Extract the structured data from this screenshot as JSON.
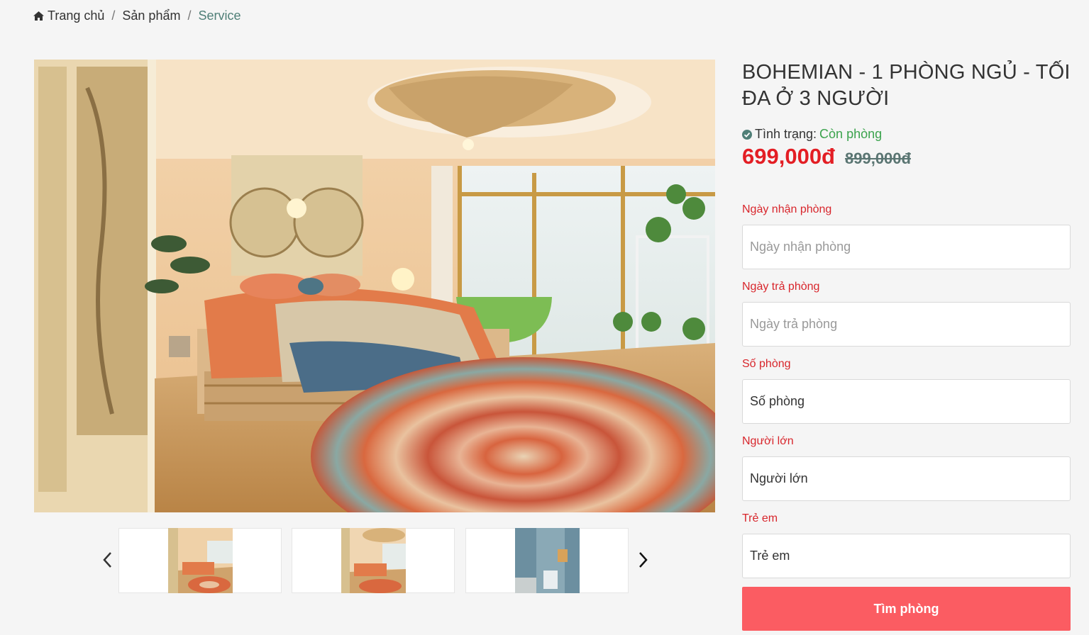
{
  "breadcrumb": {
    "home": "Trang chủ",
    "products": "Sản phẩm",
    "current": "Service",
    "separator": "/"
  },
  "product": {
    "title": "BOHEMIAN - 1 PHÒNG NGỦ - TỐI ĐA Ở 3 NGƯỜI",
    "status_label": "Tình trạng:",
    "status_value": "Còn phòng",
    "price_new": "699,000đ",
    "price_old": "899,000đ"
  },
  "form": {
    "checkin": {
      "label": "Ngày nhận phòng",
      "placeholder": "Ngày nhận phòng"
    },
    "checkout": {
      "label": "Ngày trả phòng",
      "placeholder": "Ngày trả phòng"
    },
    "rooms": {
      "label": "Số phòng",
      "placeholder": "Số phòng"
    },
    "adults": {
      "label": "Người lớn",
      "placeholder": "Người lớn"
    },
    "children": {
      "label": "Trẻ em",
      "placeholder": "Trẻ em"
    },
    "submit": "Tìm phòng"
  },
  "icons": {
    "home": "home-icon",
    "check": "check-circle-icon",
    "prev": "chevron-left-icon",
    "next": "chevron-right-icon"
  },
  "colors": {
    "accent_red": "#e31e24",
    "label_red": "#d8262c",
    "status_green": "#3ba34d",
    "button": "#fb5c62",
    "breadcrumb_active": "#4f7f77"
  }
}
